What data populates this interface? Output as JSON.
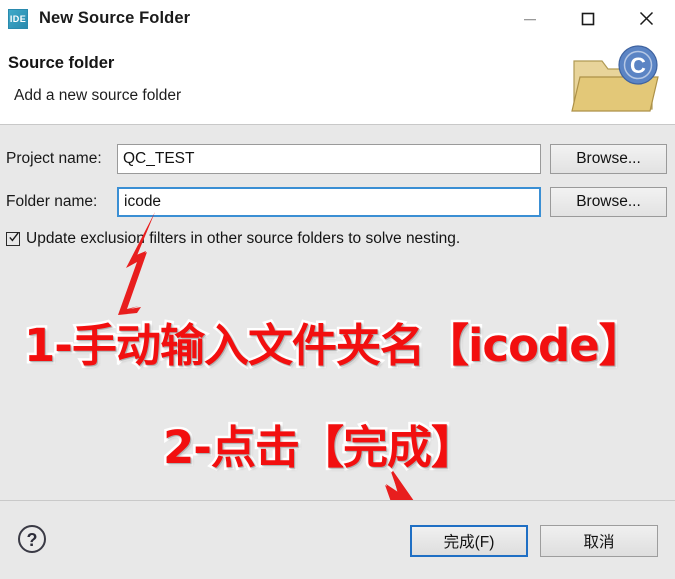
{
  "window": {
    "title": "New Source Folder",
    "app_icon_label": "IDE",
    "controls": {
      "minimize": "minimize-button",
      "maximize": "maximize-button",
      "close": "close-button"
    }
  },
  "header": {
    "title": "Source folder",
    "description": "Add a new source folder",
    "icon": "folder-with-c-badge-icon"
  },
  "form": {
    "project": {
      "label": "Project name:",
      "value": "QC_TEST",
      "placeholder": "",
      "browse_label": "Browse..."
    },
    "folder": {
      "label": "Folder name:",
      "value": "icode",
      "placeholder": "",
      "browse_label": "Browse...",
      "focused": true
    },
    "checkbox": {
      "label": "Update exclusion filters in other source folders to solve nesting.",
      "checked": true
    }
  },
  "annotations": [
    {
      "id": "step-1",
      "text": "1-手动输入文件夹名【icode】",
      "color": "#f20f0f"
    },
    {
      "id": "step-2",
      "text": "2-点击【完成】",
      "color": "#f20f0f"
    }
  ],
  "footer": {
    "help_icon": "help-question-icon",
    "finish_label": "完成(F)",
    "cancel_label": "取消"
  },
  "colors": {
    "accent": "#1f6fc4",
    "annotation_red": "#f20f0f",
    "dialog_background": "#e8e8e8",
    "header_background": "#ffffff",
    "app_icon_blue": "#2a8aae"
  }
}
